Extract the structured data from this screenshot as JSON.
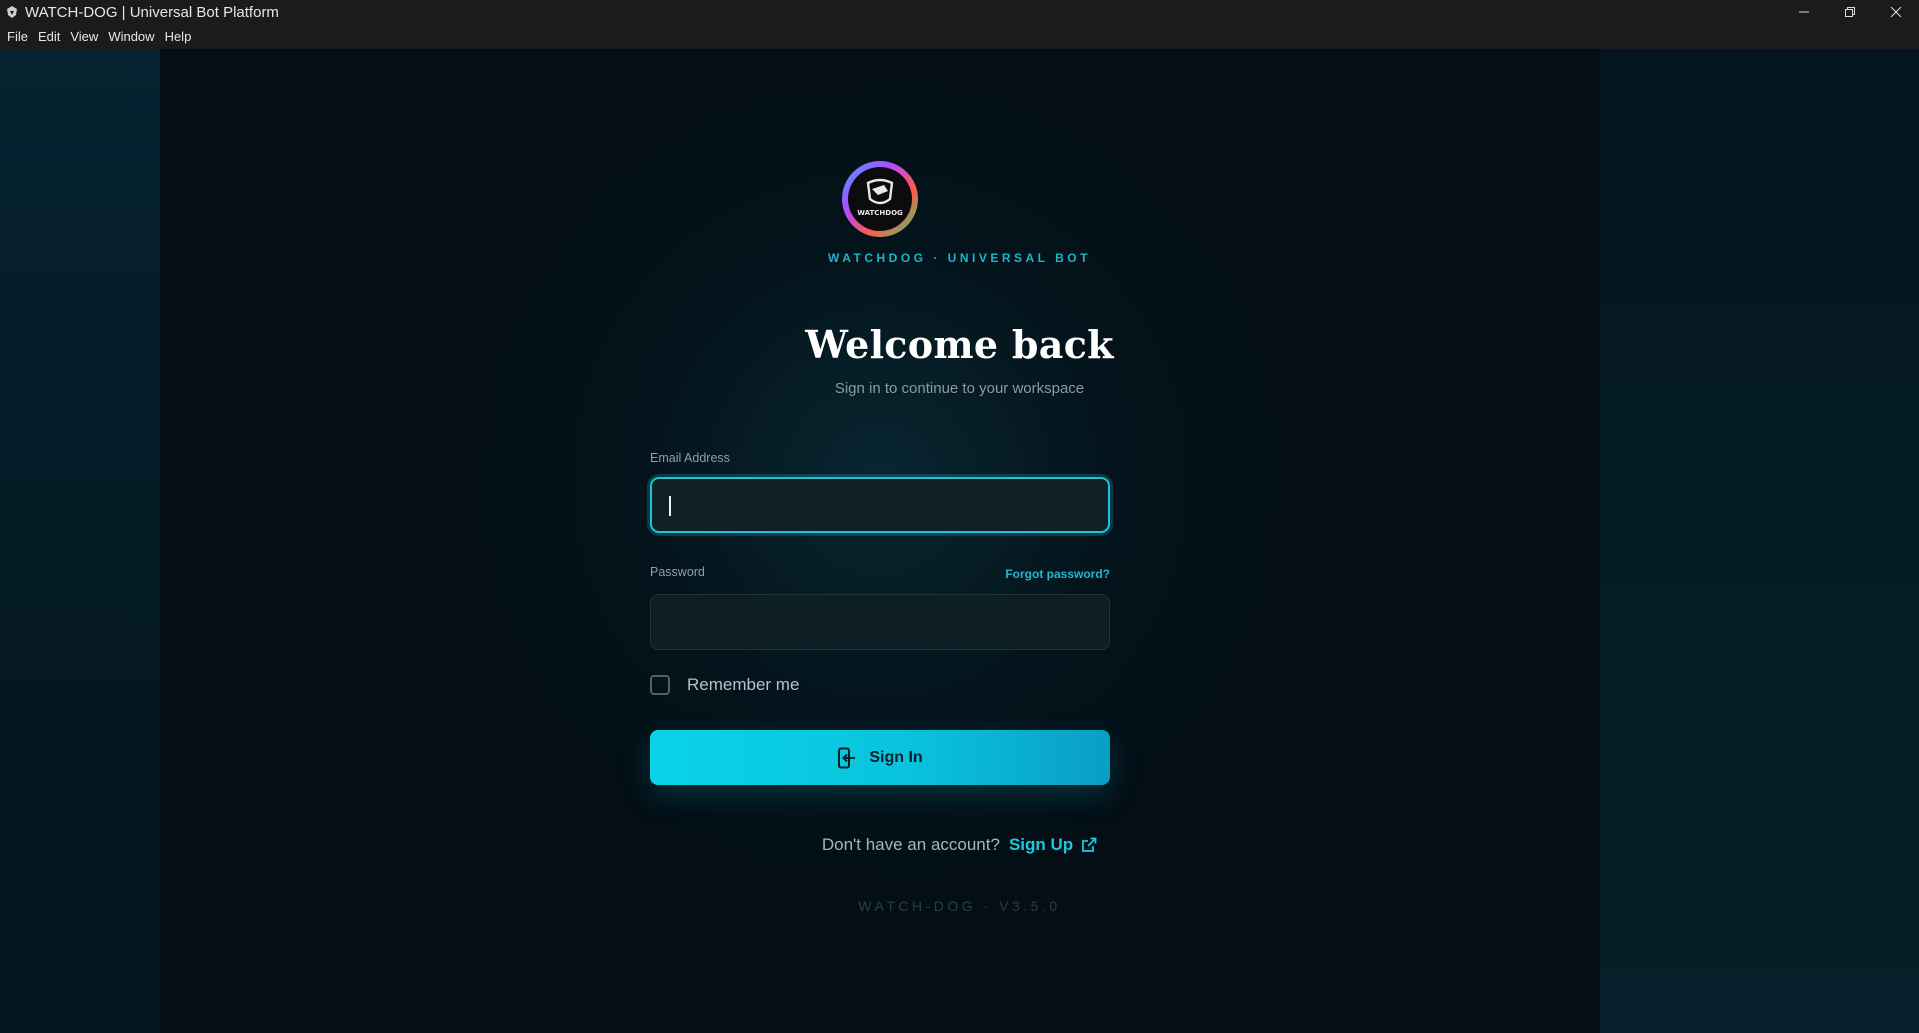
{
  "window": {
    "title": "WATCH-DOG | Universal Bot Platform",
    "app_icon": "watchdog-app-icon",
    "controls": [
      "minimize-icon",
      "restore-icon",
      "close-icon"
    ]
  },
  "menubar": {
    "items": [
      "File",
      "Edit",
      "View",
      "Window",
      "Help"
    ]
  },
  "brand": {
    "logo_icon": "watchdog-shield-logo",
    "logo_text": "WATCHDOG",
    "tagline": "WATCHDOG · UNIVERSAL BOT"
  },
  "login": {
    "heading": "Welcome back",
    "subtitle": "Sign in to continue to your workspace",
    "email": {
      "label": "Email Address",
      "value": "",
      "placeholder": "",
      "focused": true
    },
    "password": {
      "label": "Password",
      "value": "",
      "placeholder": "",
      "forgot_link": "Forgot password?"
    },
    "remember": {
      "label": "Remember me",
      "checked": false
    },
    "submit": {
      "label": "Sign In",
      "icon": "sign-in-icon"
    },
    "signup": {
      "question": "Don't have an account?",
      "link_label": "Sign Up",
      "icon": "external-link-icon"
    },
    "version": "WATCH-DOG · V3.5.0"
  },
  "colors": {
    "accent": "#1ec8dc",
    "button_start": "#0ad3e8",
    "button_end": "#0a9ec4",
    "background": "#030e15",
    "input_bg": "#0e1e25"
  }
}
